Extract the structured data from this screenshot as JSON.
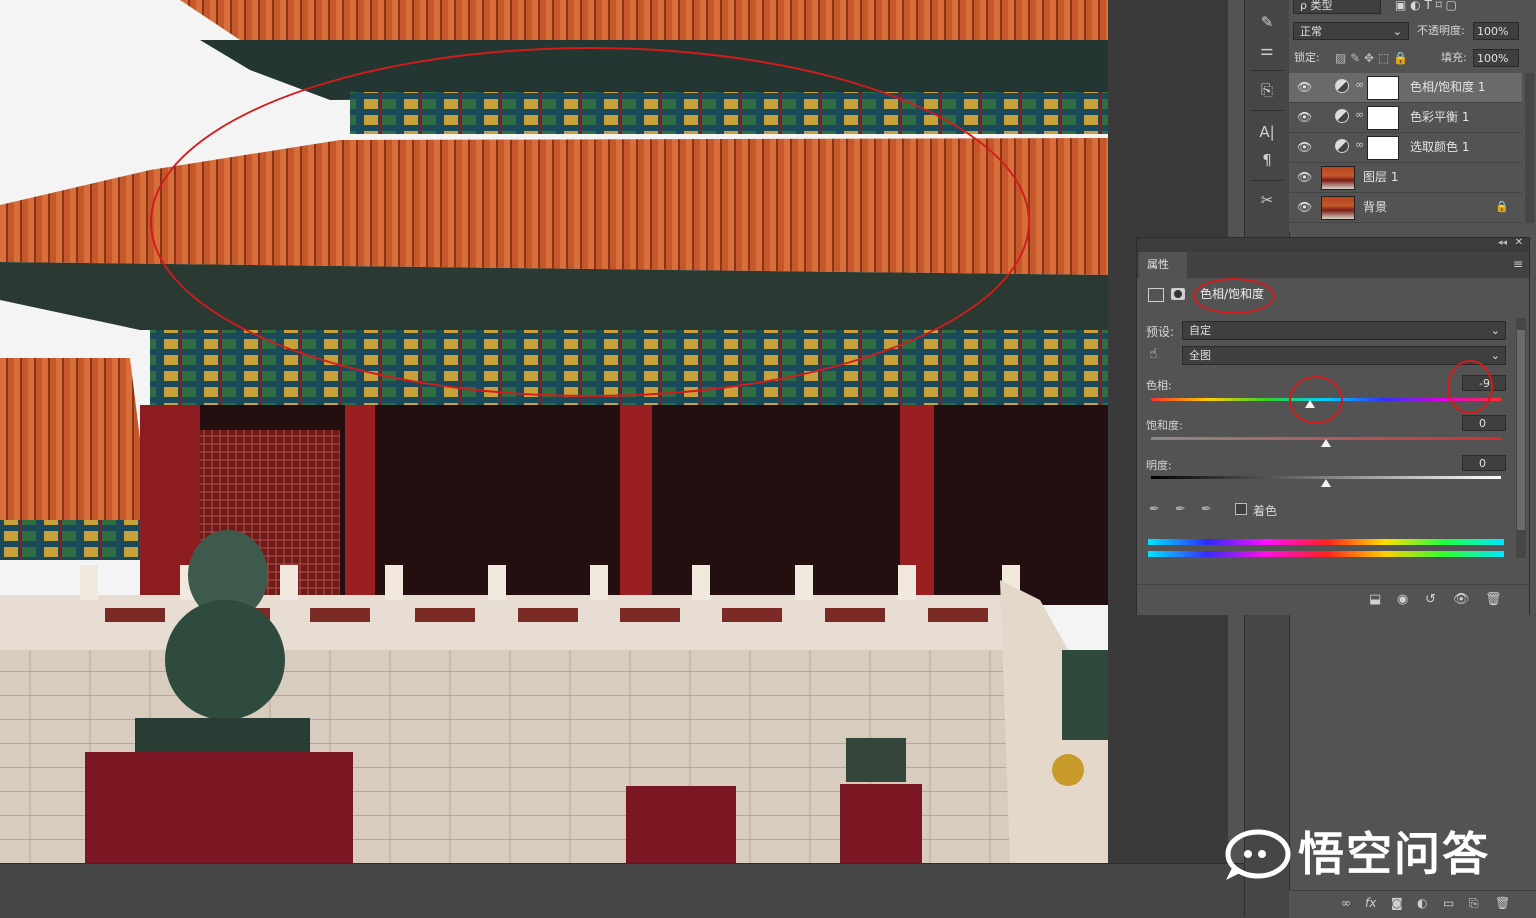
{
  "layers_panel": {
    "filter_kind": "ρ 类型",
    "blend_mode": "正常",
    "opacity_label": "不透明度:",
    "opacity_value": "100%",
    "lock_label": "锁定:",
    "fill_label": "填充:",
    "fill_value": "100%",
    "layers": [
      {
        "name": "色相/饱和度 1",
        "kind": "adjustment",
        "visible": true,
        "active": true
      },
      {
        "name": "色彩平衡 1",
        "kind": "adjustment",
        "visible": true,
        "active": false
      },
      {
        "name": "选取颜色 1",
        "kind": "adjustment",
        "visible": true,
        "active": false
      },
      {
        "name": "图层 1",
        "kind": "pixel",
        "visible": true,
        "active": false
      },
      {
        "name": "背景",
        "kind": "pixel",
        "visible": true,
        "active": false,
        "locked": true
      }
    ]
  },
  "properties_panel": {
    "tab_label": "属性",
    "adjustment_title": "色相/饱和度",
    "preset_label": "预设:",
    "preset_value": "自定",
    "range_value": "全图",
    "hue_label": "色相:",
    "hue_value": "-9",
    "saturation_label": "饱和度:",
    "saturation_value": "0",
    "lightness_label": "明度:",
    "lightness_value": "0",
    "colorize_label": "着色",
    "colorize_checked": false
  },
  "watermark": {
    "text": "悟空问答"
  },
  "colors": {
    "panel_bg": "#535353",
    "annotation_red": "#d21c1c"
  }
}
